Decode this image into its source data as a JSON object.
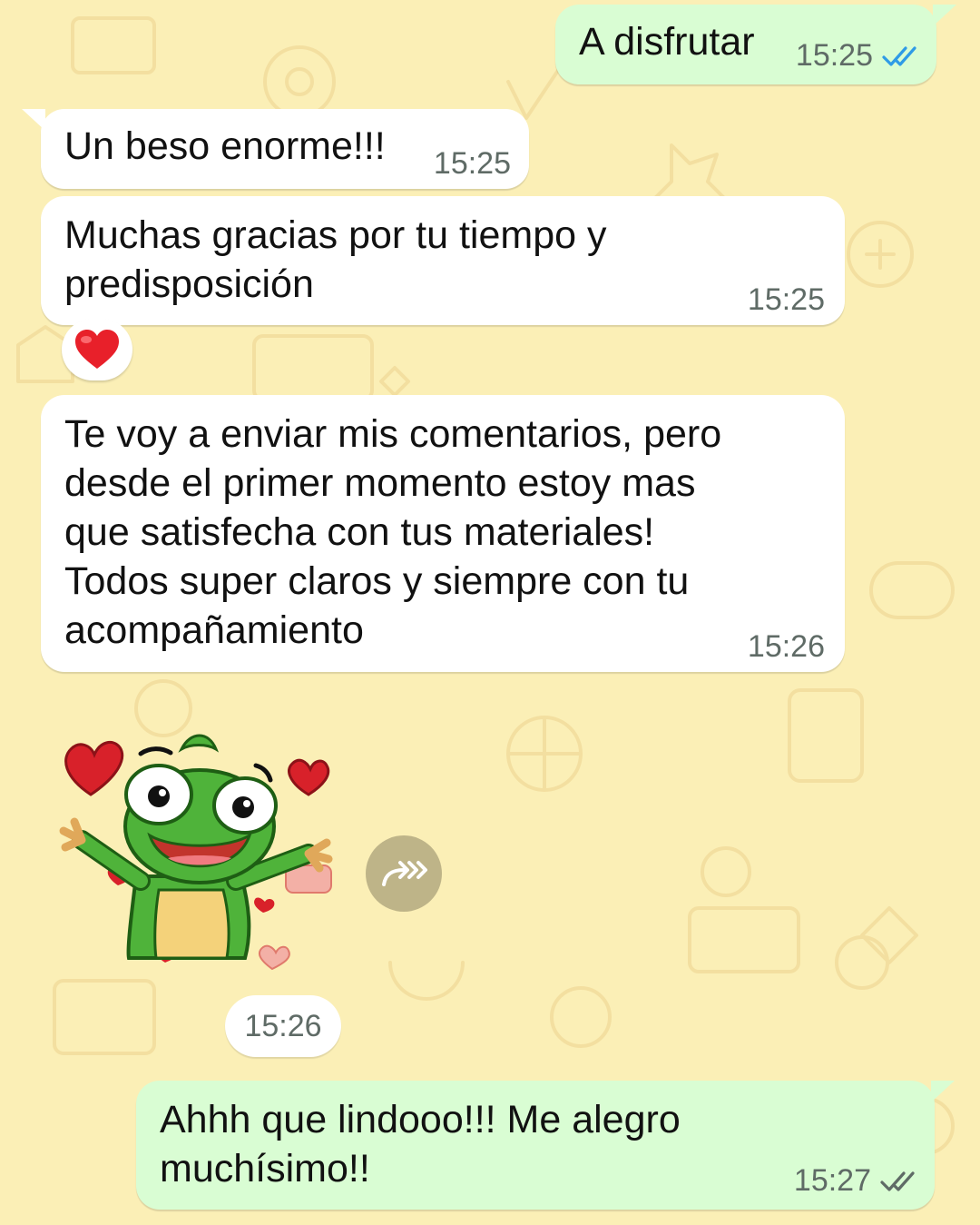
{
  "colors": {
    "wallpaper": "#fbefb6",
    "incoming_bubble": "#ffffff",
    "outgoing_bubble": "#d9fdd3",
    "read_ticks": "#2f9be6",
    "delivered_ticks": "#5f6b66"
  },
  "messages": [
    {
      "direction": "out",
      "text": "A disfrutar",
      "time": "15:25",
      "status": "read-double-check-icon"
    },
    {
      "direction": "in",
      "text": "Un beso enorme!!!",
      "time": "15:25"
    },
    {
      "direction": "in",
      "text": "Muchas gracias por tu tiempo y\npredisposición",
      "time": "15:25",
      "reaction": "❤"
    },
    {
      "direction": "in",
      "text": "Te voy a enviar mis comentarios, pero\ndesde el primer momento estoy mas\nque satisfecha con tus materiales!\nTodos super claros y siempre con tu\nacompañamiento",
      "time": "15:26"
    },
    {
      "direction": "in",
      "type": "sticker",
      "sticker": "frog-hearts-sticker",
      "time": "15:26"
    },
    {
      "direction": "out",
      "text": "Ahhh que lindooo!!! Me alegro\nmuchísimo!!",
      "time": "15:27",
      "status": "delivered-double-check-icon"
    }
  ]
}
